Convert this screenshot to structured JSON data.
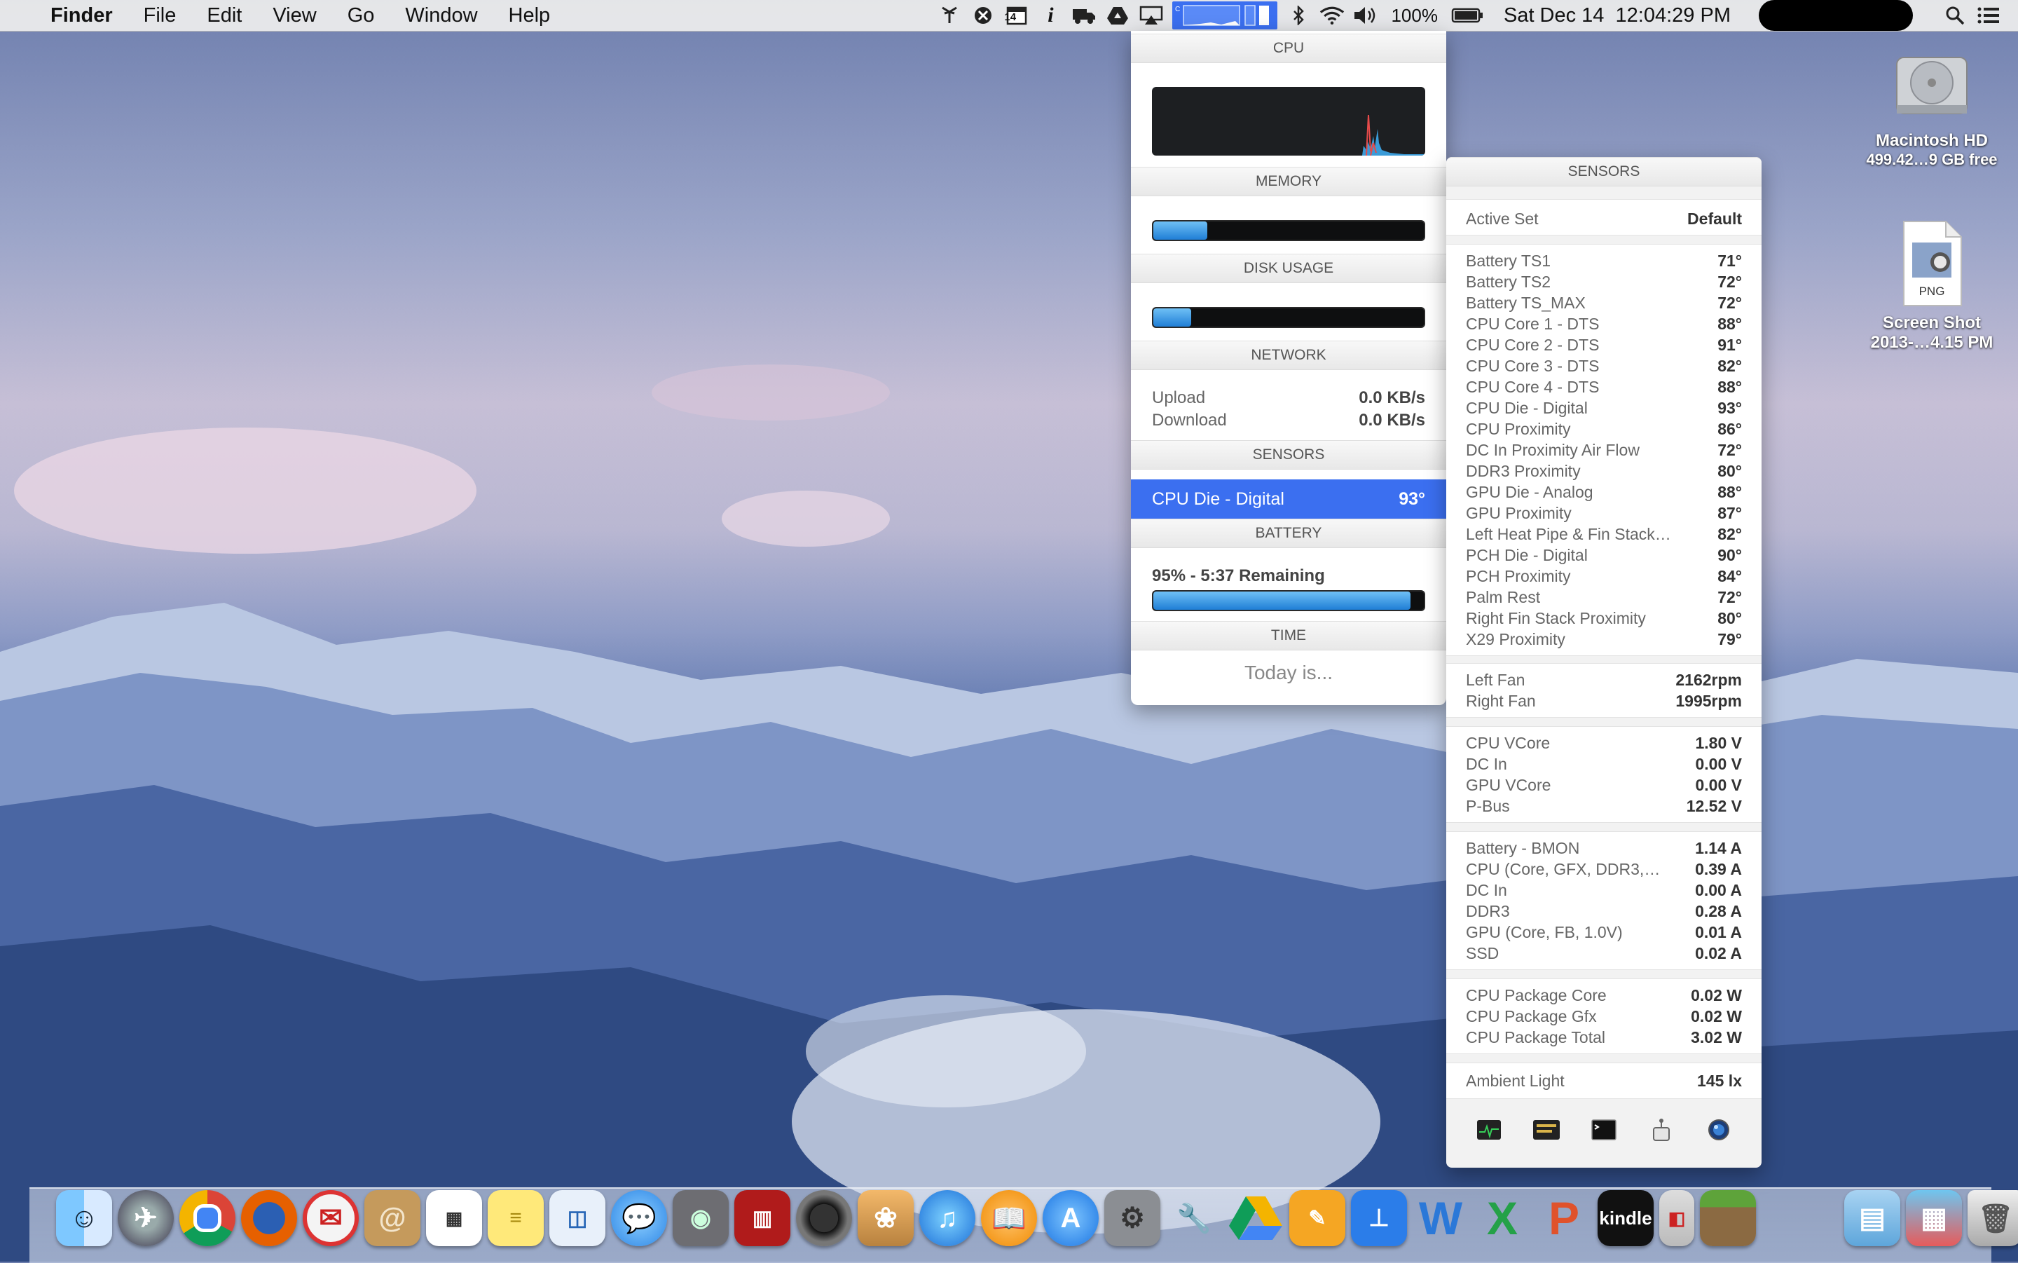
{
  "menubar": {
    "app_name": "Finder",
    "menus": [
      "File",
      "Edit",
      "View",
      "Go",
      "Window",
      "Help"
    ],
    "calendar_icon_text": "14",
    "battery_percent": "100%",
    "clock": "Sat Dec 14  12:04:29 PM"
  },
  "desktop": {
    "hd_name": "Macintosh HD",
    "hd_free": "499.42…9 GB free",
    "file_type": "PNG",
    "file_name_1": "Screen Shot",
    "file_name_2": "2013-…4.15 PM"
  },
  "panel": {
    "cpu_head": "CPU",
    "memory_head": "MEMORY",
    "memory_fill": 0.2,
    "disk_head": "DISK USAGE",
    "disk_fill": 0.14,
    "network_head": "NETWORK",
    "upload_label": "Upload",
    "upload_value": "0.0 KB/s",
    "download_label": "Download",
    "download_value": "0.0 KB/s",
    "sensors_head": "SENSORS",
    "sensor_selected_label": "CPU Die - Digital",
    "sensor_selected_value": "93°",
    "battery_head": "BATTERY",
    "battery_text": "95% - 5:37 Remaining",
    "battery_fill": 0.95,
    "time_head": "TIME",
    "time_text": "Today is..."
  },
  "sensors": {
    "head": "SENSORS",
    "active_set_label": "Active Set",
    "active_set_value": "Default",
    "temps": [
      {
        "name": "Battery TS1",
        "value": "71°"
      },
      {
        "name": "Battery TS2",
        "value": "72°"
      },
      {
        "name": "Battery TS_MAX",
        "value": "72°"
      },
      {
        "name": "CPU Core 1 - DTS",
        "value": "88°"
      },
      {
        "name": "CPU Core 2 - DTS",
        "value": "91°"
      },
      {
        "name": "CPU Core 3 - DTS",
        "value": "82°"
      },
      {
        "name": "CPU Core 4 - DTS",
        "value": "88°"
      },
      {
        "name": "CPU Die - Digital",
        "value": "93°"
      },
      {
        "name": "CPU Proximity",
        "value": "86°"
      },
      {
        "name": "DC In Proximity Air Flow",
        "value": "72°"
      },
      {
        "name": "DDR3 Proximity",
        "value": "80°"
      },
      {
        "name": "GPU Die - Analog",
        "value": "88°"
      },
      {
        "name": "GPU Proximity",
        "value": "87°"
      },
      {
        "name": "Left Heat Pipe & Fin Stack…",
        "value": "82°"
      },
      {
        "name": "PCH Die - Digital",
        "value": "90°"
      },
      {
        "name": "PCH Proximity",
        "value": "84°"
      },
      {
        "name": "Palm Rest",
        "value": "72°"
      },
      {
        "name": "Right Fin Stack Proximity",
        "value": "80°"
      },
      {
        "name": "X29 Proximity",
        "value": "79°"
      }
    ],
    "fans": [
      {
        "name": "Left Fan",
        "value": "2162rpm"
      },
      {
        "name": "Right Fan",
        "value": "1995rpm"
      }
    ],
    "voltages": [
      {
        "name": "CPU VCore",
        "value": "1.80 V"
      },
      {
        "name": "DC In",
        "value": "0.00 V"
      },
      {
        "name": "GPU VCore",
        "value": "0.00 V"
      },
      {
        "name": "P-Bus",
        "value": "12.52 V"
      }
    ],
    "currents": [
      {
        "name": "Battery - BMON",
        "value": "1.14 A"
      },
      {
        "name": "CPU (Core, GFX, DDR3,…",
        "value": "0.39 A"
      },
      {
        "name": "DC In",
        "value": "0.00 A"
      },
      {
        "name": "DDR3",
        "value": "0.28 A"
      },
      {
        "name": "GPU (Core, FB, 1.0V)",
        "value": "0.01 A"
      },
      {
        "name": "SSD",
        "value": "0.02 A"
      }
    ],
    "power": [
      {
        "name": "CPU Package Core",
        "value": "0.02 W"
      },
      {
        "name": "CPU Package Gfx",
        "value": "0.02 W"
      },
      {
        "name": "CPU Package Total",
        "value": "3.02 W"
      }
    ],
    "ambient_label": "Ambient Light",
    "ambient_value": "145 lx"
  },
  "dock": {
    "kindle_label": "kindle",
    "apps": [
      "finder-icon",
      "launchpad-icon",
      "chrome-icon",
      "firefox-icon",
      "mail-stamp-icon",
      "contacts-icon",
      "calendar-icon",
      "notes-icon",
      "preview-icon",
      "messages-icon",
      "facetime-icon",
      "photo-booth-icon",
      "aperture-icon",
      "iphoto-icon",
      "itunes-icon",
      "ibooks-icon",
      "app-store-icon",
      "system-preferences-icon",
      "wrench-app-icon",
      "google-drive-icon",
      "pages-icon",
      "keynote-icon",
      "word-icon",
      "excel-icon",
      "powerpoint-icon",
      "kindle-icon",
      "cola-icon",
      "minecraft-icon",
      "folder-icon",
      "stacks-icon",
      "trash-icon"
    ]
  },
  "colors": {
    "accent": "#3b6ff0",
    "bar_fill": "#1f7ed6"
  }
}
